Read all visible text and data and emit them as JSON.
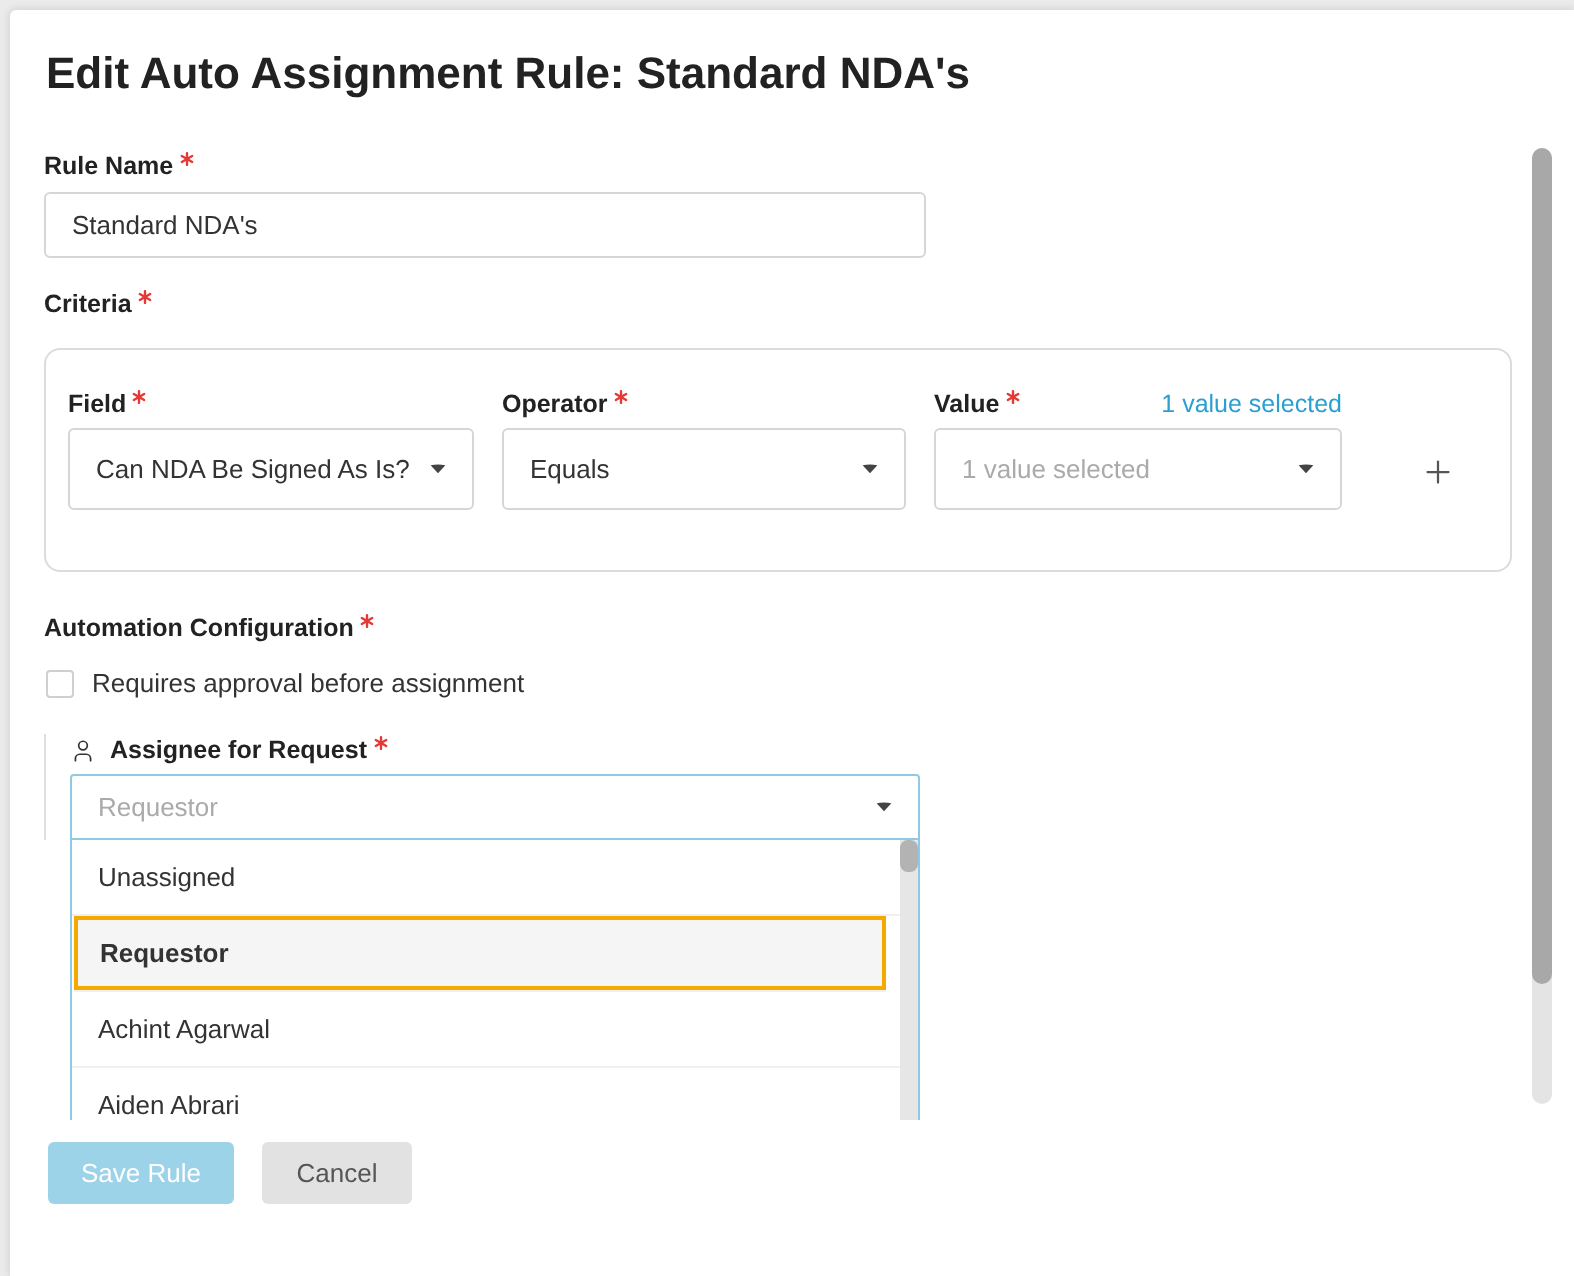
{
  "dialog": {
    "title": "Edit Auto Assignment Rule: Standard NDA's"
  },
  "rule_name": {
    "label": "Rule Name",
    "required": true,
    "value": "Standard NDA's"
  },
  "criteria": {
    "label": "Criteria",
    "required": true,
    "conditions": [
      {
        "kind": "select",
        "label": "Field",
        "required": true,
        "value": "Can NDA Be Signed As Is?"
      },
      {
        "kind": "select",
        "label": "Operator",
        "required": true,
        "value": "Equals"
      },
      {
        "kind": "multiselect",
        "label": "Value",
        "required": true,
        "placeholder": "1 value selected",
        "summary": "1 value selected"
      }
    ]
  },
  "automation": {
    "label": "Automation Configuration",
    "required": true,
    "approval": {
      "label": "Requires approval before assignment",
      "checked": false
    },
    "assignee": {
      "label": "Assignee for Request",
      "required": true,
      "placeholder": "Requestor",
      "expanded": true,
      "options": [
        {
          "label": "Unassigned",
          "selected": false
        },
        {
          "label": "Requestor",
          "selected": true
        },
        {
          "label": "Achint Agarwal",
          "selected": false
        },
        {
          "label": "Aiden Abrari",
          "selected": false
        }
      ]
    }
  },
  "buttons": [
    {
      "label": "Save Rule",
      "kind": "primary",
      "disabled": true
    },
    {
      "label": "Cancel",
      "kind": "secondary",
      "disabled": false
    }
  ]
}
